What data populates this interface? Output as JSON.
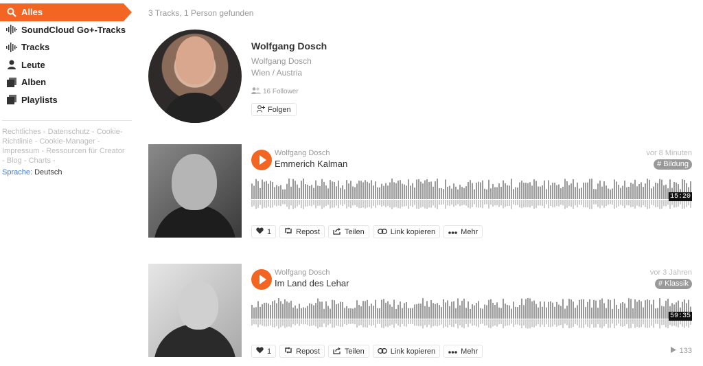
{
  "sidebar": {
    "items": [
      {
        "label": "Alles",
        "icon": "search-icon",
        "active": true
      },
      {
        "label": "SoundCloud Go+-Tracks",
        "icon": "soundwave-icon"
      },
      {
        "label": "Tracks",
        "icon": "soundwave-icon"
      },
      {
        "label": "Leute",
        "icon": "person-icon"
      },
      {
        "label": "Alben",
        "icon": "album-icon"
      },
      {
        "label": "Playlists",
        "icon": "playlist-icon"
      }
    ],
    "footer_links": [
      "Rechtliches",
      "Datenschutz",
      "Cookie-Richtlinie",
      "Cookie-Manager",
      "Impressum",
      "Ressourcen für Creator",
      "Blog",
      "Charts"
    ],
    "language_label": "Sprache:",
    "language_value": "Deutsch"
  },
  "results_summary": "3 Tracks, 1 Person gefunden",
  "person": {
    "name": "Wolfgang Dosch",
    "username": "Wolfgang Dosch",
    "location": "Wien / Austria",
    "followers": "16 Follower",
    "follow_label": "Folgen"
  },
  "tracks": [
    {
      "artist": "Wolfgang Dosch",
      "title": "Emmerich Kalman",
      "posted": "vor 8 Minuten",
      "tag": "# Bildung",
      "duration": "15:20",
      "likes": "1",
      "plays": ""
    },
    {
      "artist": "Wolfgang Dosch",
      "title": "Im Land des Lehar",
      "posted": "vor 3 Jahren",
      "tag": "# Klassik",
      "duration": "59:35",
      "likes": "1",
      "plays": "133"
    }
  ],
  "actions": {
    "repost": "Repost",
    "share": "Teilen",
    "copy_link": "Link kopieren",
    "more": "Mehr"
  },
  "colors": {
    "accent": "#f26522",
    "waveform": "#999999",
    "tag": "#999999"
  }
}
